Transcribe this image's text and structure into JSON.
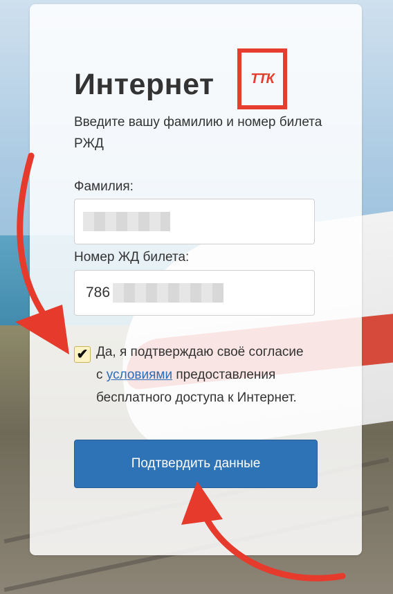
{
  "header": {
    "title": "Интернет",
    "logo_text": "ТТК"
  },
  "instruction": "Введите вашу фамилию и номер билета РЖД",
  "form": {
    "surname_label": "Фамилия:",
    "surname_value": "",
    "ticket_label": "Номер ЖД билета:",
    "ticket_value": "786",
    "consent": {
      "checked": true,
      "text_before": "Да, я подтверждаю своё согласие с ",
      "link_text": "условиями",
      "text_after": " предоставления бесплатного доступа к Интернет."
    },
    "submit_label": "Подтвердить данные"
  },
  "colors": {
    "accent_red": "#e63d2f",
    "button_blue": "#2f73b7",
    "link_blue": "#2b6cb8",
    "annotation_arrow": "#e53a2c"
  }
}
